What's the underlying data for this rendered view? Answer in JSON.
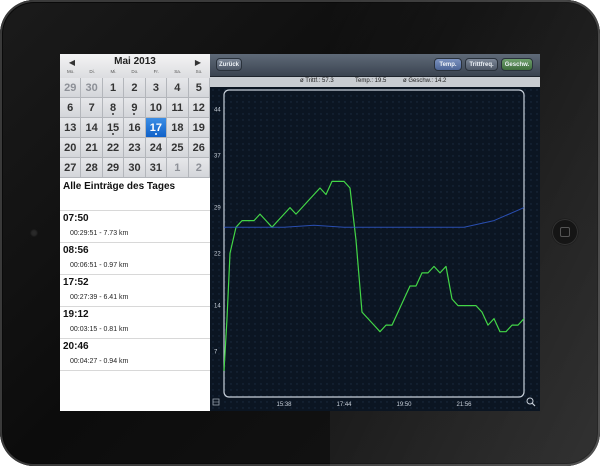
{
  "colors": {
    "device_bezel": "#121212",
    "chart_bg": "#0b1522",
    "speed_line": "#43d647",
    "temp_line": "#2f58c9",
    "selected_day": "#1a6fd6"
  },
  "calendar": {
    "month": "Mai 2013",
    "prev_icon": "◀",
    "next_icon": "▶",
    "weekdays": [
      "Mo.",
      "Di.",
      "Mi.",
      "Do.",
      "Fr.",
      "Sa.",
      "So."
    ],
    "selected_day": "17",
    "days": [
      "29",
      "30",
      "1",
      "2",
      "3",
      "4",
      "5",
      "6",
      "7",
      "8",
      "9",
      "10",
      "11",
      "12",
      "13",
      "14",
      "15",
      "16",
      "17",
      "18",
      "19",
      "20",
      "21",
      "22",
      "23",
      "24",
      "25",
      "26",
      "27",
      "28",
      "29",
      "30",
      "31",
      "1",
      "2"
    ]
  },
  "entries_title": "Alle Einträge des Tages",
  "entries": [
    {
      "time": "07:50",
      "detail": "00:29:51 - 7.73 km"
    },
    {
      "time": "08:56",
      "detail": "00:06:51 - 0.97 km"
    },
    {
      "time": "17:52",
      "detail": "00:27:39 - 6.41 km"
    },
    {
      "time": "19:12",
      "detail": "00:03:15 - 0.81 km"
    },
    {
      "time": "20:46",
      "detail": "00:04:27 - 0.94 km"
    }
  ],
  "toolbar": {
    "back_label": "Zurück",
    "temp_label": "Temp.",
    "cadence_label": "Trittfreq.",
    "speed_label": "Geschw."
  },
  "stats": {
    "cadence": "ø Trittf.: 57.3",
    "temp": "Temp.: 19.5",
    "speed": "ø Geschw.: 14.2"
  },
  "chart_data": {
    "type": "line",
    "x_ticks": [
      "15:38",
      "17:44",
      "19:50",
      "21:56"
    ],
    "y_ticks": [
      "44",
      "37",
      "29",
      "22",
      "14",
      "7"
    ],
    "ylim": [
      0,
      47
    ],
    "series": [
      {
        "key": "speed",
        "color": "#43d647",
        "x": [
          0,
          1,
          2,
          3,
          4,
          6,
          8,
          10,
          12,
          14,
          16,
          18,
          20,
          22,
          24,
          26,
          28,
          30,
          32,
          34,
          36,
          38,
          40,
          42,
          44,
          46,
          48,
          50,
          52,
          54,
          56,
          58,
          60,
          62,
          64,
          66,
          68,
          70,
          72,
          74,
          76,
          78,
          80,
          82,
          84,
          86,
          88,
          90,
          92,
          94,
          96,
          98,
          100
        ],
        "y": [
          4,
          12,
          22,
          24,
          26,
          27,
          27,
          27,
          28,
          27,
          26,
          27,
          28,
          29,
          28,
          29,
          30,
          31,
          32,
          31,
          33,
          33,
          33,
          32,
          24,
          13,
          12,
          11,
          10,
          11,
          11,
          13,
          15,
          17,
          17,
          19,
          19,
          20,
          19,
          20,
          15,
          14,
          14,
          14,
          14,
          13,
          11,
          12,
          10,
          10,
          11,
          11,
          12
        ]
      },
      {
        "key": "temperature",
        "color": "#2f58c9",
        "x": [
          0,
          10,
          20,
          30,
          40,
          50,
          60,
          70,
          80,
          90,
          100
        ],
        "y": [
          26,
          26,
          26,
          26.3,
          26,
          26,
          26,
          26,
          26,
          27,
          29
        ]
      }
    ]
  }
}
